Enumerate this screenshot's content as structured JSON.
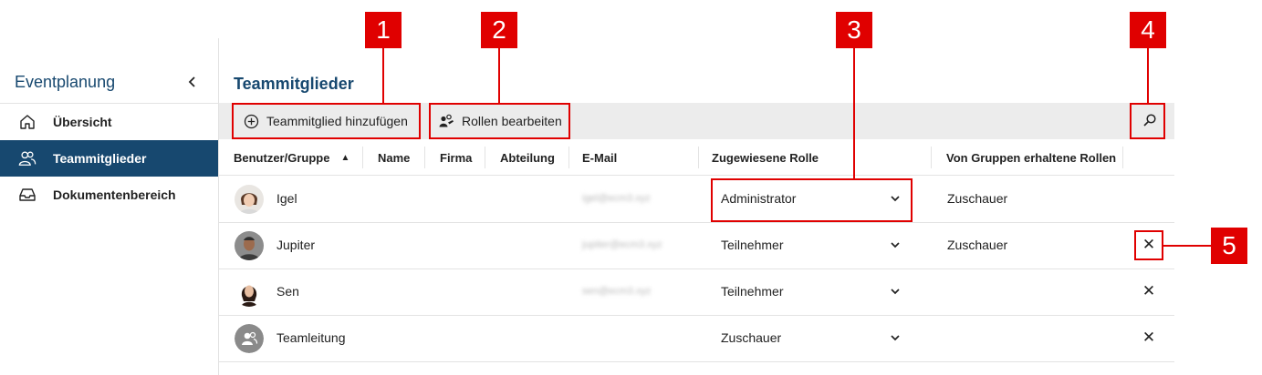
{
  "sidebar": {
    "title": "Eventplanung",
    "collapse_icon": "chevron-left-icon",
    "items": [
      {
        "label": "Übersicht",
        "icon": "home-icon",
        "active": false
      },
      {
        "label": "Teammitglieder",
        "icon": "users-icon",
        "active": true
      },
      {
        "label": "Dokumentenbereich",
        "icon": "inbox-icon",
        "active": false
      }
    ]
  },
  "main": {
    "title": "Teammitglieder",
    "toolbar": {
      "add_label": "Teammitglied hinzufügen",
      "roles_label": "Rollen bearbeiten",
      "search_icon": "search-icon"
    },
    "columns": [
      "Benutzer/Gruppe",
      "Name",
      "Firma",
      "Abteilung",
      "E-Mail",
      "Zugewiesene Rolle",
      "Von Gruppen erhaltene Rollen"
    ],
    "sort_indicator": "▲",
    "rows": [
      {
        "user": "Igel",
        "email": "igel@ecm3.xyz",
        "role": "Administrator",
        "group_roles": "Zuschauer",
        "deletable": false
      },
      {
        "user": "Jupiter",
        "email": "jupiter@ecm3.xyz",
        "role": "Teilnehmer",
        "group_roles": "Zuschauer",
        "deletable": true
      },
      {
        "user": "Sen",
        "email": "sen@ecm3.xyz",
        "role": "Teilnehmer",
        "group_roles": "",
        "deletable": true
      },
      {
        "user": "Teamleitung",
        "email": "",
        "role": "Zuschauer",
        "group_roles": "",
        "deletable": true
      }
    ]
  },
  "callouts": [
    "1",
    "2",
    "3",
    "4",
    "5"
  ],
  "colors": {
    "accent": "#17486f",
    "toolbar_bg": "#ececec",
    "callout_red": "#e00000"
  }
}
